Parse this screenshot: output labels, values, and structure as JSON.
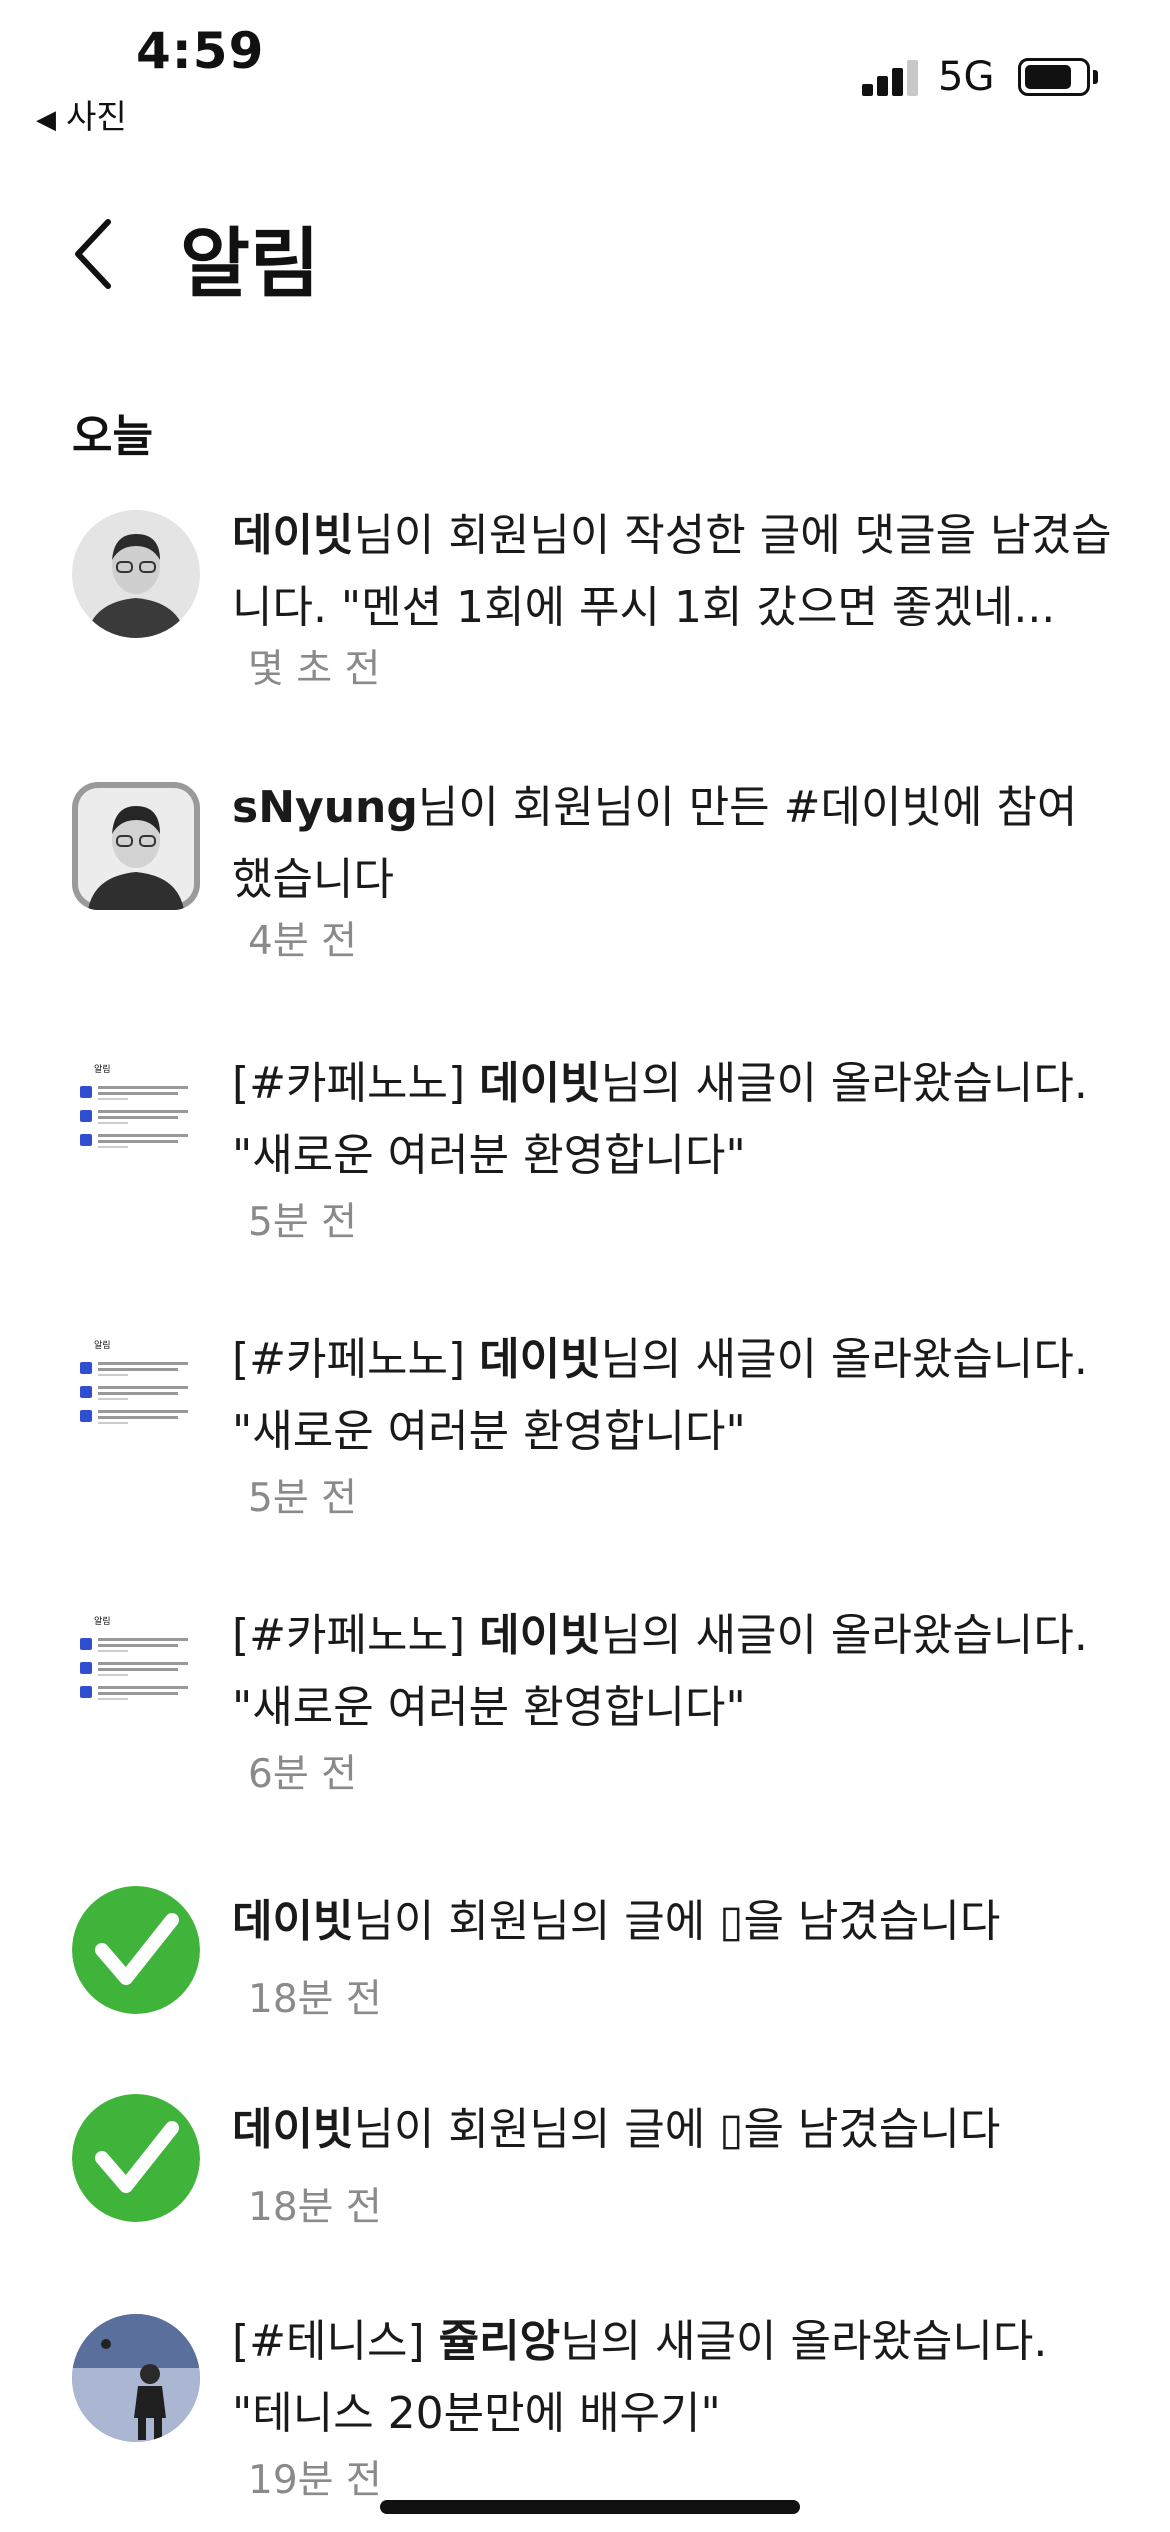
{
  "status_bar": {
    "time": "4:59",
    "back_app": "사진",
    "network": "5G"
  },
  "header": {
    "title": "알림"
  },
  "section": {
    "label": "오늘"
  },
  "notifications": [
    {
      "bold": "데이빗",
      "text": "님이 회원님이 작성한 글에 댓글을 남겼습니다. \"멘션 1회에 푸시 1회 갔으면 좋겠네...",
      "time": "몇 초 전",
      "avatar": "person-photo"
    },
    {
      "bold": "sNyung",
      "text": "님이 회원님이 만든 #데이빗에 참여했습니다",
      "time": "4분 전",
      "avatar": "person-photo-square"
    },
    {
      "prefix": "[#카페노노] ",
      "bold": "데이빗",
      "text": "님의 새글이 올라왔습니다. \"새로운 여러분 환영합니다\"",
      "time": "5분 전",
      "avatar": "screenshot-thumbnail",
      "thumb_title": "알림"
    },
    {
      "prefix": "[#카페노노] ",
      "bold": "데이빗",
      "text": "님의 새글이 올라왔습니다. \"새로운 여러분 환영합니다\"",
      "time": "5분 전",
      "avatar": "screenshot-thumbnail",
      "thumb_title": "알림"
    },
    {
      "prefix": "[#카페노노] ",
      "bold": "데이빗",
      "text": "님의 새글이 올라왔습니다. \"새로운 여러분 환영합니다\"",
      "time": "6분 전",
      "avatar": "screenshot-thumbnail",
      "thumb_title": "알림"
    },
    {
      "bold": "데이빗",
      "text": "님이 회원님의 글에 ▯을 남겼습니다",
      "time": "18분 전",
      "avatar": "green-check"
    },
    {
      "bold": "데이빗",
      "text": "님이 회원님의 글에 ▯을 남겼습니다",
      "time": "18분 전",
      "avatar": "green-check"
    },
    {
      "prefix": "[#테니스] ",
      "bold": "쥴리앙",
      "text": "님의 새글이 올라왔습니다. \"테니스 20분만에 배우기\"",
      "time": "19분 전",
      "avatar": "tennis-photo"
    }
  ],
  "colors": {
    "check_green": "#3fb33a",
    "time_gray": "#8a8a8a",
    "text": "#1a1a1a"
  }
}
